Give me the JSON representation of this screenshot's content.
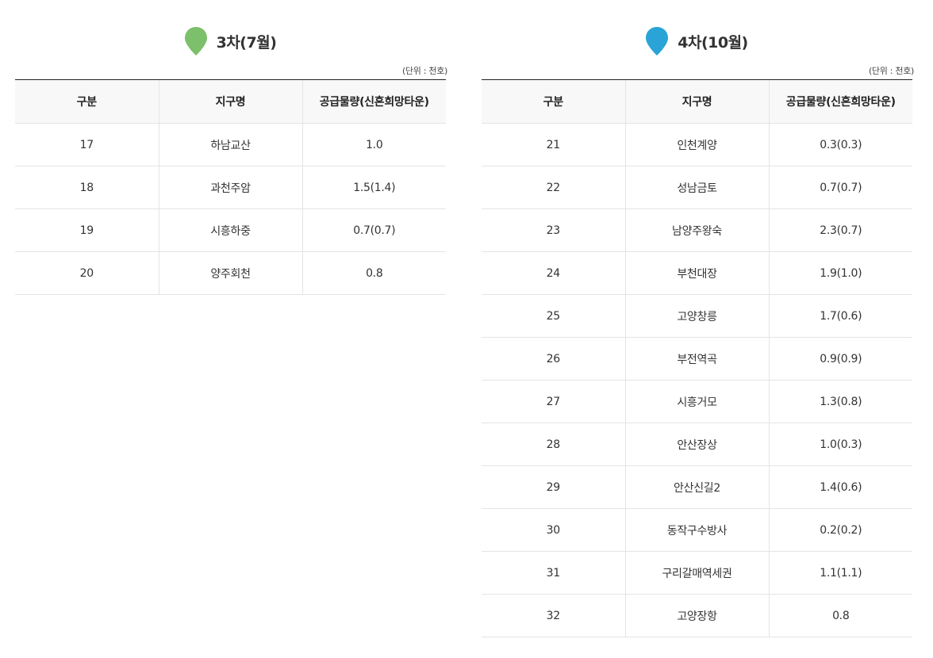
{
  "left": {
    "title": "3차(7월)",
    "pin_color": "#7cc06b",
    "unit": "(단위 : 천호)",
    "headers": [
      "구분",
      "지구명",
      "공급물량(신혼희망타운)"
    ],
    "rows": [
      [
        "17",
        "하남교산",
        "1.0"
      ],
      [
        "18",
        "과천주암",
        "1.5(1.4)"
      ],
      [
        "19",
        "시흥하중",
        "0.7(0.7)"
      ],
      [
        "20",
        "양주회천",
        "0.8"
      ]
    ]
  },
  "right": {
    "title": "4차(10월)",
    "pin_color": "#2aa3d6",
    "unit": "(단위 : 천호)",
    "headers": [
      "구분",
      "지구명",
      "공급물량(신혼희망타운)"
    ],
    "rows": [
      [
        "21",
        "인천계양",
        "0.3(0.3)"
      ],
      [
        "22",
        "성남금토",
        "0.7(0.7)"
      ],
      [
        "23",
        "남양주왕숙",
        "2.3(0.7)"
      ],
      [
        "24",
        "부천대장",
        "1.9(1.0)"
      ],
      [
        "25",
        "고양창릉",
        "1.7(0.6)"
      ],
      [
        "26",
        "부전역곡",
        "0.9(0.9)"
      ],
      [
        "27",
        "시흥거모",
        "1.3(0.8)"
      ],
      [
        "28",
        "안산장상",
        "1.0(0.3)"
      ],
      [
        "29",
        "안산신길2",
        "1.4(0.6)"
      ],
      [
        "30",
        "동작구수방사",
        "0.2(0.2)"
      ],
      [
        "31",
        "구리갈매역세권",
        "1.1(1.1)"
      ],
      [
        "32",
        "고양장항",
        "0.8"
      ]
    ]
  }
}
